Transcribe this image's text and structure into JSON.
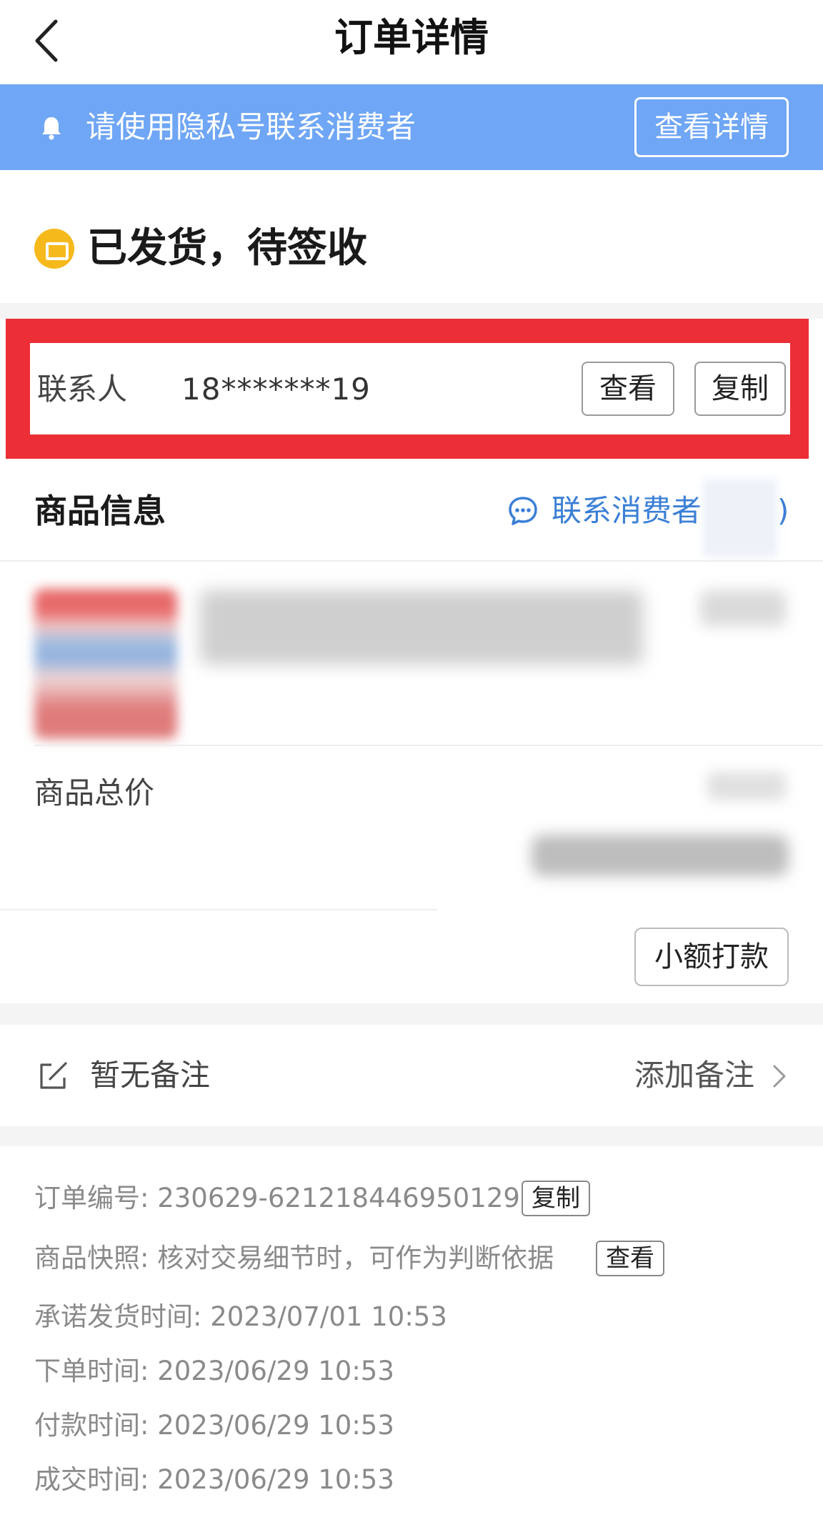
{
  "header": {
    "title": "订单详情"
  },
  "banner": {
    "text": "请使用隐私号联系消费者",
    "button": "查看详情"
  },
  "status": {
    "text": "已发货，待签收"
  },
  "contact": {
    "label": "联系人",
    "phone": "18*******19",
    "view_button": "查看",
    "copy_button": "复制"
  },
  "goods": {
    "title": "商品信息",
    "contact_consumer": "联系消费者",
    "paren_close": ")",
    "total_label": "商品总价",
    "small_payment_button": "小额打款"
  },
  "remark": {
    "empty_text": "暂无备注",
    "add_label": "添加备注"
  },
  "order_info": {
    "order_no": "订单编号: 230629-621218446950129",
    "copy_button": "复制",
    "snapshot": "商品快照: 核对交易细节时，可作为判断依据",
    "view_button": "查看",
    "promised_ship": "承诺发货时间: 2023/07/01 10:53",
    "ordered": "下单时间: 2023/06/29 10:53",
    "paid": "付款时间: 2023/06/29 10:53",
    "completed": "成交时间: 2023/06/29 10:53"
  },
  "colors": {
    "banner": "#6fa6f5",
    "highlight_frame": "#ec2e36",
    "status_icon": "#f6b91c",
    "link": "#3b7fd6"
  },
  "icons": {
    "back": "chevron-left-icon",
    "bell": "bell-icon",
    "status": "package-icon",
    "chat": "chat-bubble-icon",
    "edit": "edit-note-icon",
    "chevron": "chevron-right-icon"
  }
}
